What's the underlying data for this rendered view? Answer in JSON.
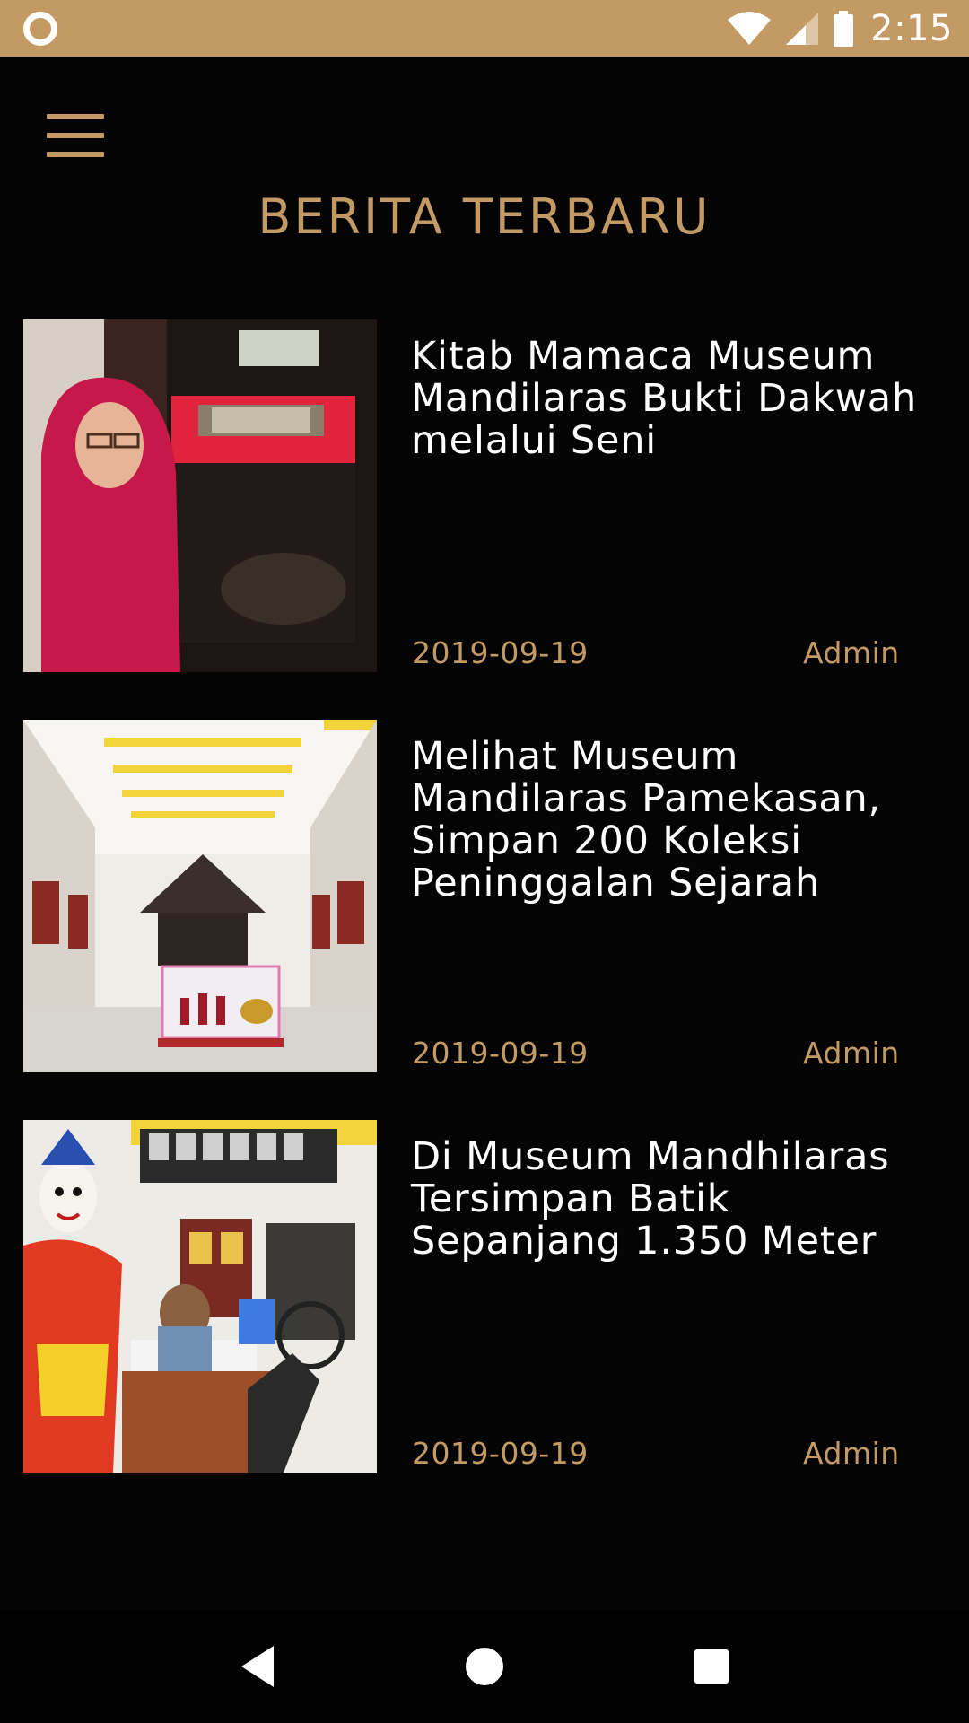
{
  "status_bar": {
    "time": "2:15",
    "icons": [
      "sync-icon",
      "wifi-icon",
      "cell-signal-icon",
      "battery-icon"
    ]
  },
  "header": {
    "title": "BERITA TERBARU",
    "menu_icon": "hamburger-menu-icon"
  },
  "news": [
    {
      "title": "Kitab Mamaca Museum Mandilaras Bukti Dakwah melalui Seni",
      "date": "2019-09-19",
      "author": "Admin"
    },
    {
      "title": "Melihat Museum Mandilaras Pamekasan, Simpan 200 Koleksi Peninggalan Sejarah",
      "date": "2019-09-19",
      "author": "Admin"
    },
    {
      "title": "Di Museum Mandhilaras Tersimpan Batik Sepanjang 1.350 Meter",
      "date": "2019-09-19",
      "author": "Admin"
    }
  ],
  "nav_bar": {
    "buttons": [
      "back-icon",
      "home-icon",
      "recents-icon"
    ]
  },
  "colors": {
    "accent": "#c39a63",
    "background": "#050405",
    "text": "#ffffff"
  }
}
